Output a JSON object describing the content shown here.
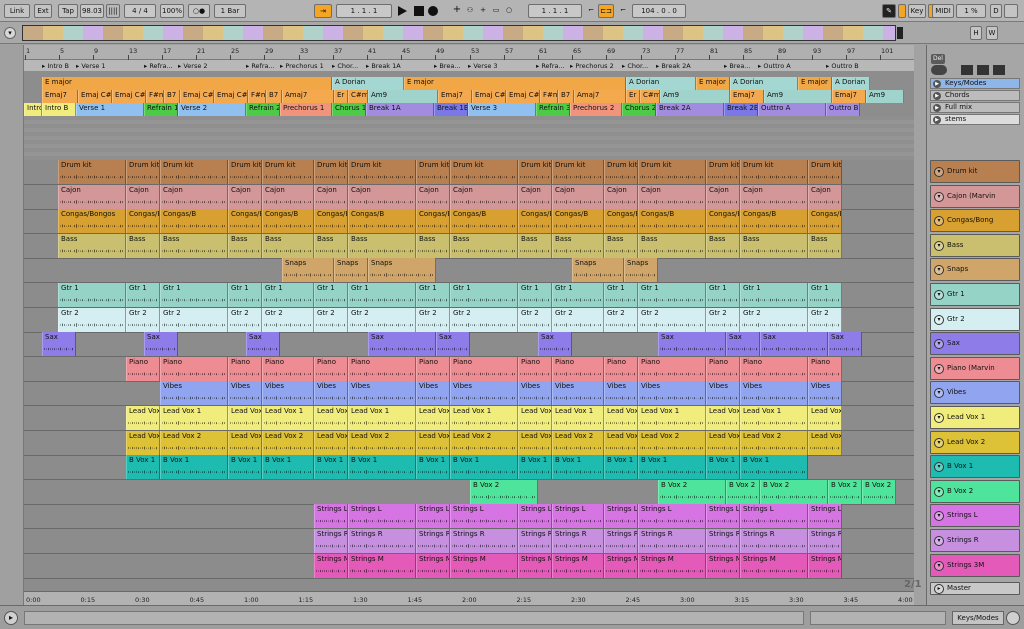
{
  "colors": {
    "drum": "#b88050",
    "cajon": "#d29796",
    "congas": "#d8a030",
    "bass": "#c9bf6e",
    "snaps": "#cfa56a",
    "gtr1": "#94d3c6",
    "gtr2": "#d4eef2",
    "sax": "#8e7ce8",
    "piano": "#ee8c93",
    "vibes": "#90a4ef",
    "leadvox1": "#f1ed7c",
    "leadvox2": "#ddc136",
    "bvox1": "#1ebcb0",
    "bvox2": "#4fe49b",
    "stringsl": "#d574e2",
    "stringsr": "#c68fe0",
    "stringsm": "#e35ab8",
    "keyorange": "#f2a746",
    "keydorian": "#a4d6d2",
    "chordorange": "#f4a94f",
    "chordteal": "#9fd3cc",
    "selection": "#f6c443"
  },
  "toolbar": {
    "link": "Link",
    "ext": "Ext",
    "tap": "Tap",
    "tempo": "98.03",
    "tempo_bars": "||||",
    "signature": "4 / 4",
    "zoom": "100%",
    "metro": "○●",
    "quant": "1 Bar",
    "position": "1 .   1 .   1",
    "loop_start": "1 .   1 .   1",
    "loop_length": "104 .   0 .   0",
    "key": "Key",
    "midi": "MIDI",
    "cpu": "1 %",
    "d": "D"
  },
  "overview": {
    "h": "H",
    "w": "W"
  },
  "ruler": {
    "bars": [
      "1",
      "5",
      "9",
      "13",
      "17",
      "21",
      "25",
      "29",
      "33",
      "37",
      "41",
      "45",
      "49",
      "53",
      "57",
      "61",
      "65",
      "69",
      "73",
      "77",
      "81",
      "85",
      "89",
      "93",
      "97",
      "101"
    ]
  },
  "key_row": [
    {
      "label": "E major",
      "w": 290
    },
    {
      "label": "A Dorian",
      "w": 72
    },
    {
      "label": "E major",
      "w": 222
    },
    {
      "label": "A Dorian",
      "w": 70
    },
    {
      "label": "E major",
      "w": 34
    },
    {
      "label": "A Dorian",
      "w": 68
    },
    {
      "label": "E major",
      "w": 34
    },
    {
      "label": "A Dorian",
      "w": 38
    }
  ],
  "chord_row": [
    {
      "label": "Emaj7",
      "w": 36
    },
    {
      "label": "Emaj C#m",
      "w": 34
    },
    {
      "label": "Emaj C#m",
      "w": 34
    },
    {
      "label": "F#m",
      "w": 18
    },
    {
      "label": "B7",
      "w": 16
    },
    {
      "label": "Emaj C#m",
      "w": 34
    },
    {
      "label": "Emaj C#m",
      "w": 34
    },
    {
      "label": "F#m",
      "w": 18
    },
    {
      "label": "B7",
      "w": 16
    },
    {
      "label": "Amaj7",
      "w": 52
    },
    {
      "label": "Er",
      "w": 14
    },
    {
      "label": "C#m",
      "w": 20
    },
    {
      "label": "Am9",
      "w": 70
    },
    {
      "label": "Emaj7",
      "w": 34
    },
    {
      "label": "Emaj C#m",
      "w": 34
    },
    {
      "label": "Emaj C#m",
      "w": 34
    },
    {
      "label": "F#m",
      "w": 18
    },
    {
      "label": "B7",
      "w": 16
    },
    {
      "label": "Amaj7",
      "w": 52
    },
    {
      "label": "Er",
      "w": 14
    },
    {
      "label": "C#m",
      "w": 20
    },
    {
      "label": "Am9",
      "w": 70
    },
    {
      "label": "Emaj7",
      "w": 34
    },
    {
      "label": "Am9",
      "w": 68
    },
    {
      "label": "Emaj7",
      "w": 34
    },
    {
      "label": "Am9",
      "w": 38
    }
  ],
  "section_row": [
    {
      "label": "Intro",
      "w": 18,
      "c": "#f1ed7c"
    },
    {
      "label": "Intro B",
      "w": 34,
      "c": "#f1ed7c"
    },
    {
      "label": "Verse 1",
      "w": 68,
      "c": "#90c0f0"
    },
    {
      "label": "Refrain 1",
      "w": 34,
      "c": "#4ecb46"
    },
    {
      "label": "Verse 2",
      "w": 68,
      "c": "#90c0f0"
    },
    {
      "label": "Refrain 2",
      "w": 34,
      "c": "#4ecb46"
    },
    {
      "label": "Prechorus 1",
      "w": 52,
      "c": "#f0957c"
    },
    {
      "label": "Chorus 1",
      "w": 34,
      "c": "#4ecb46"
    },
    {
      "label": "Break 1A",
      "w": 68,
      "c": "#a28ce0"
    },
    {
      "label": "Break 1B",
      "w": 34,
      "c": "#7a78e6"
    },
    {
      "label": "Verse 3",
      "w": 68,
      "c": "#90c0f0"
    },
    {
      "label": "Refrain 3",
      "w": 34,
      "c": "#4ecb46"
    },
    {
      "label": "Prechorus 2",
      "w": 52,
      "c": "#f0957c"
    },
    {
      "label": "Chorus 2",
      "w": 34,
      "c": "#4ecb46"
    },
    {
      "label": "Break 2A",
      "w": 68,
      "c": "#a28ce0"
    },
    {
      "label": "Break 2B",
      "w": 34,
      "c": "#7a78e6"
    },
    {
      "label": "Outtro A",
      "w": 68,
      "c": "#a28ce0"
    },
    {
      "label": "Outtro B",
      "w": 34,
      "c": "#a28ce0"
    }
  ],
  "locators": [
    "Intro B",
    "Verse 1",
    "Refra...",
    "Verse 2",
    "Refra...",
    "Prechorus 1",
    "Chor...",
    "Break 1A",
    "Brea...",
    "Verse 3",
    "Refra...",
    "Prechorus 2",
    "Chor...",
    "Break 2A",
    "Brea...",
    "Outtro A",
    "Outtro B"
  ],
  "tracks": [
    {
      "name": "Drum kit",
      "color": "drum",
      "lbls": [
        "Drum kit",
        "Drum kit",
        "Drum kit",
        "Drum kit",
        "Drum kit",
        "Drum kit",
        "Drum kit",
        "Drum kit",
        "Drum kit",
        "Drum kit",
        "Drum kit",
        "Drum kit",
        "Drum kit",
        "Drum kit",
        "Drum kit",
        "Drum kit",
        "Drum kit"
      ]
    },
    {
      "name": "Cajon (Marvin",
      "color": "cajon",
      "lbls": [
        "Cajon",
        "Cajon",
        "Cajon",
        "Cajon",
        "Cajon",
        "Cajon",
        "Cajon",
        "Cajon",
        "Cajon",
        "Cajon",
        "Cajon",
        "Cajon",
        "Cajon",
        "Cajon",
        "Cajon",
        "Cajon",
        "Cajon"
      ]
    },
    {
      "name": "Congas/Bong",
      "color": "congas",
      "lbls": [
        "Congas/Bongos",
        "Congas/Bongos",
        "Congas/B",
        "Congas/Bongos",
        "Congas/B",
        "Congas/Bongos",
        "Congas/B",
        "Congas/Bongos",
        "Congas/B",
        "Congas/Bongos",
        "Congas/B",
        "Congas/Bongos",
        "Congas/B",
        "Congas/Bongos",
        "Congas/B",
        "Congas/Bongos",
        "Congas/B"
      ]
    },
    {
      "name": "Bass",
      "color": "bass",
      "lbls": [
        "Bass",
        "Bass",
        "Bass",
        "Bass",
        "Bass",
        "Bass",
        "Bass",
        "Bass",
        "Bass",
        "Bass",
        "Bass",
        "Bass",
        "Bass",
        "Bass",
        "Bass",
        "Bass",
        "Bass"
      ]
    },
    {
      "name": "Snaps",
      "color": "snaps",
      "lbls": [
        "Snaps",
        "Snaps",
        "Snaps",
        "Snaps",
        "Snaps"
      ]
    },
    {
      "name": "Gtr 1",
      "color": "gtr1",
      "lbls": [
        "Gtr 1",
        "Gtr 1",
        "Gtr 1",
        "Gtr 1",
        "Gtr 1",
        "Gtr 1",
        "Gtr 1",
        "Gtr 1",
        "Gtr 1",
        "Gtr 1",
        "Gtr 1",
        "Gtr 1",
        "Gtr 1",
        "Gtr 1",
        "Gtr 1",
        "Gtr 1",
        "Gtr 1"
      ]
    },
    {
      "name": "Gtr 2",
      "color": "gtr2",
      "lbls": [
        "Gtr 2",
        "Gtr 2",
        "Gtr 2",
        "Gtr 2",
        "Gtr 2",
        "Gtr 2",
        "Gtr 2",
        "Gtr 2",
        "Gtr 2",
        "Gtr 2",
        "Gtr 2",
        "Gtr 2",
        "Gtr 2",
        "Gtr 2",
        "Gtr 2",
        "Gtr 2",
        "Gtr 2"
      ]
    },
    {
      "name": "Sax",
      "color": "sax",
      "lbls": [
        "Sax",
        "Sax",
        "Sax",
        "Sax",
        "Sax",
        "Sax",
        "Sax",
        "Sax",
        "Sax"
      ]
    },
    {
      "name": "Piano (Marvin",
      "color": "piano",
      "lbls": [
        "Piano",
        "Piano",
        "Piano",
        "Piano",
        "Piano",
        "Piano",
        "Piano",
        "Piano",
        "Piano",
        "Piano",
        "Piano",
        "Piano",
        "Piano",
        "Piano",
        "Piano",
        "Piano"
      ]
    },
    {
      "name": "Vibes",
      "color": "vibes",
      "lbls": [
        "Vibes",
        "Vibes",
        "Vibes",
        "Vibes",
        "Vibes",
        "Vibes",
        "Vibes",
        "Vibes",
        "Vibes",
        "Vibes",
        "Vibes",
        "Vibes",
        "Vibes",
        "Vibes",
        "Vibes"
      ]
    },
    {
      "name": "Lead Vox 1",
      "color": "leadvox1",
      "lbls": [
        "Lead Vox 1",
        "Lead Vox 1",
        "Lead Vox 1",
        "Lead Vox 1",
        "Lead Vox 1",
        "Lead Vox 1",
        "Lead Vox 1",
        "Lead Vox 1",
        "Lead Vox 1",
        "Lead Vox 1",
        "Lead Vox 1",
        "Lead Vox 1",
        "Lead Vox 1",
        "Lead Vox 1",
        "Lead Vox 1"
      ]
    },
    {
      "name": "Lead Vox 2",
      "color": "leadvox2",
      "lbls": [
        "Lead Vox 2",
        "Lead Vox 2",
        "Lead Vox 2",
        "Lead Vox 2",
        "Lead Vox 2",
        "Lead Vox 2",
        "Lead Vox 2",
        "Lead Vox 2",
        "Lead Vox 2",
        "Lead Vox 2",
        "Lead Vox 2",
        "Lead Vox 2",
        "Lead Vox 2",
        "Lead Vox 2",
        "Lead Vox 2"
      ]
    },
    {
      "name": "B Vox 1",
      "color": "bvox1",
      "lbls": [
        "B Vox 1",
        "B Vox 1",
        "B Vox 1",
        "B Vox 1",
        "B Vox 1",
        "B Vox 1",
        "B Vox 1",
        "B Vox 1",
        "B Vox 1",
        "B Vox 1",
        "B Vox 1",
        "B Vox 1",
        "B Vox 1",
        "B Vox 1"
      ]
    },
    {
      "name": "B Vox 2",
      "color": "bvox2",
      "lbls": [
        "B Vox 2",
        "B Vox 2",
        "B Vox 2",
        "B Vox 2",
        "B Vox 2",
        "B Vox 2"
      ]
    },
    {
      "name": "Strings L",
      "color": "stringsl",
      "lbls": [
        "Strings L",
        "Strings L",
        "Strings L",
        "Strings L",
        "Strings L",
        "Strings L",
        "Strings L",
        "Strings L",
        "Strings L",
        "Strings L",
        "Strings L",
        "Strings L"
      ]
    },
    {
      "name": "Strings R",
      "color": "stringsr",
      "lbls": [
        "Strings R",
        "Strings R",
        "Strings R",
        "Strings R",
        "Strings R",
        "Strings R",
        "Strings R",
        "Strings R",
        "Strings R",
        "Strings R",
        "Strings R",
        "Strings R"
      ]
    },
    {
      "name": "Strings 3M",
      "color": "stringsm",
      "lbls": [
        "Strings M",
        "Strings M",
        "Strings M",
        "Strings M",
        "Strings M",
        "Strings M",
        "Strings M",
        "Strings M",
        "Strings M",
        "Strings M",
        "Strings M",
        "Strings M"
      ]
    }
  ],
  "scene_headers": [
    {
      "name": "Keys/Modes",
      "color": "#8eb6e8"
    },
    {
      "name": "Chords",
      "color": "#bcbcbc"
    },
    {
      "name": "Full mix",
      "color": "#bcbcbc"
    },
    {
      "name": "stems",
      "color": "#dcdcdc"
    }
  ],
  "master": "Master",
  "time_ticks": [
    "0:00",
    "0:15",
    "0:30",
    "0:45",
    "1:00",
    "1:15",
    "1:30",
    "1:45",
    "2:00",
    "2:15",
    "2:30",
    "2:45",
    "3:00",
    "3:15",
    "3:30",
    "3:45",
    "4:00"
  ],
  "page_indicator": "2/1",
  "bottom": {
    "right_label": "Keys/Modes"
  },
  "del_label": "Del"
}
